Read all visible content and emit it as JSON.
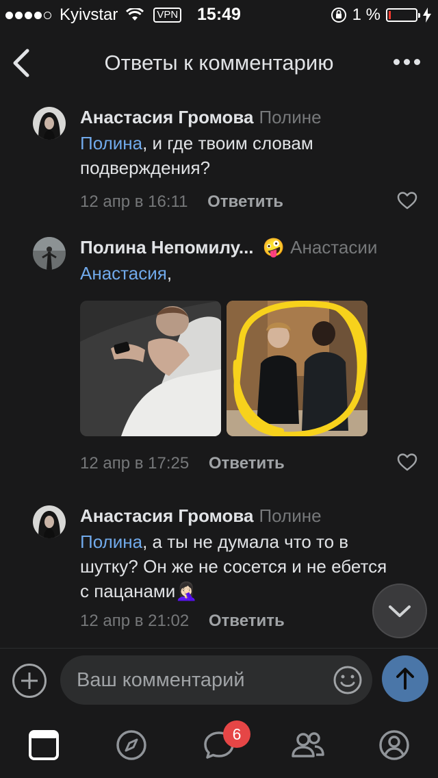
{
  "status_bar": {
    "carrier": "Kyivstar",
    "vpn": "VPN",
    "time": "15:49",
    "battery": "1 %"
  },
  "header": {
    "title": "Ответы к комментарию",
    "back_icon": "chevron-left-icon",
    "more_icon": "more-horizontal-icon"
  },
  "comments": [
    {
      "author": "Анастасия Громова",
      "reply_to": "Полине",
      "mention": "Полина",
      "text": ", и где твоим словам подверждения?",
      "date": "12 апр в 16:11",
      "reply_label": "Ответить"
    },
    {
      "author": "Полина Непомилу...",
      "emoji": "🤪",
      "reply_to": "Анастасии",
      "mention": "Анастасия",
      "text": ",",
      "date": "12 апр в 17:25",
      "reply_label": "Ответить",
      "photos": 2
    },
    {
      "author": "Анастасия Громова",
      "reply_to": "Полине",
      "mention": "Полина",
      "text": ", а ты не думала что то в шутку? Он же не сосется и не ебется с пацанами🤦🏻‍♀️",
      "date": "12 апр в 21:02",
      "reply_label": "Ответить"
    }
  ],
  "composer": {
    "placeholder": "Ваш комментарий"
  },
  "tabbar": {
    "items": [
      "news-icon",
      "explore-icon",
      "messages-icon",
      "friends-icon",
      "profile-icon"
    ],
    "messages_badge": "6"
  },
  "colors": {
    "background": "#19191a",
    "accent": "#71aaeb",
    "send_button": "#4a76a8",
    "badge": "#e64646"
  }
}
